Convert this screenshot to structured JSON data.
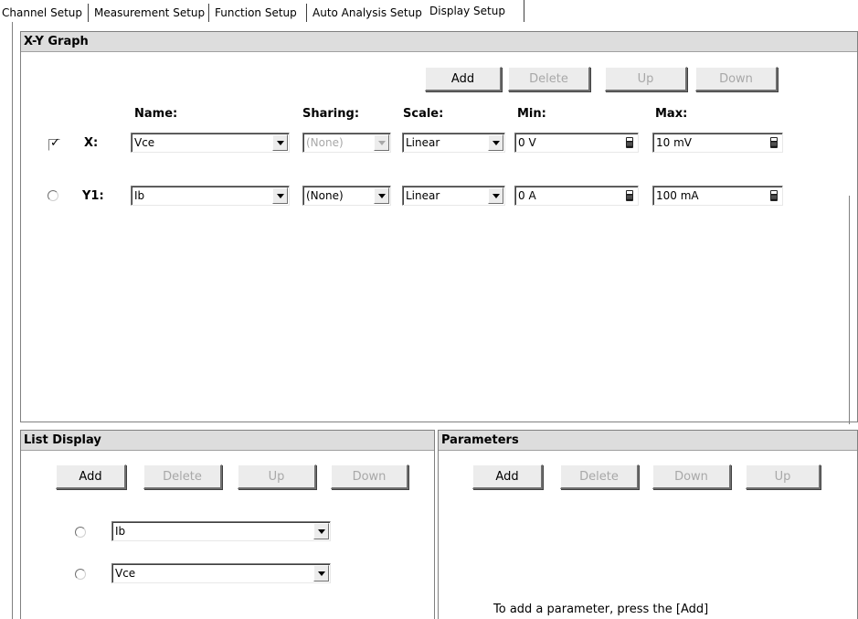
{
  "tabs": [
    {
      "label": "Channel Setup",
      "active": false
    },
    {
      "label": "Measurement Setup",
      "active": false
    },
    {
      "label": "Function Setup",
      "active": false
    },
    {
      "label": "Auto Analysis Setup",
      "active": false
    },
    {
      "label": "Display Setup",
      "active": true
    }
  ],
  "xy_graph": {
    "title": "X-Y Graph",
    "buttons": {
      "add": "Add",
      "delete": "Delete",
      "up": "Up",
      "down": "Down"
    },
    "columns": {
      "name": "Name:",
      "sharing": "Sharing:",
      "scale": "Scale:",
      "min": "Min:",
      "max": "Max:"
    },
    "rows": [
      {
        "label": "X:",
        "selector": "checkbox",
        "checked": true,
        "name": "Vce",
        "sharing": "(None)",
        "sharing_enabled": false,
        "scale": "Linear",
        "min": "0 V",
        "max": "10 mV"
      },
      {
        "label": "Y1:",
        "selector": "radio",
        "checked": false,
        "name": "Ib",
        "sharing": "(None)",
        "sharing_enabled": true,
        "scale": "Linear",
        "min": "0 A",
        "max": "100 mA"
      }
    ]
  },
  "list_display": {
    "title": "List Display",
    "buttons": {
      "add": "Add",
      "delete": "Delete",
      "up": "Up",
      "down": "Down"
    },
    "items": [
      "Ib",
      "Vce"
    ]
  },
  "parameters": {
    "title": "Parameters",
    "buttons": {
      "add": "Add",
      "delete": "Delete",
      "down": "Down",
      "up": "Up"
    },
    "hint": "To add a parameter, press the [Add]"
  },
  "icons": {
    "checkmark": "check-icon",
    "dropdown": "chevron-down-icon",
    "calculator": "calculator-icon"
  },
  "colors": {
    "panel_header": "#dddddd",
    "disabled_text": "#a8a8a8",
    "button_face": "#ececec"
  }
}
